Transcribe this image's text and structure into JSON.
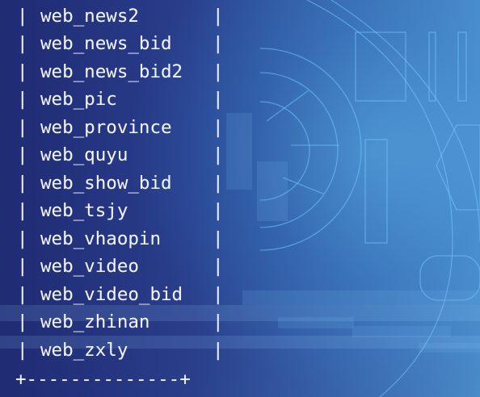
{
  "terminal": {
    "rows": [
      "web_news2",
      "web_news_bid",
      "web_news_bid2",
      "web_pic",
      "web_province",
      "web_quyu",
      "web_show_bid",
      "web_tsjy",
      "web_vhaopin",
      "web_video",
      "web_video_bid",
      "web_zhinan",
      "web_zxly"
    ],
    "pipe": "|",
    "bottom_border": "+--------------+"
  }
}
